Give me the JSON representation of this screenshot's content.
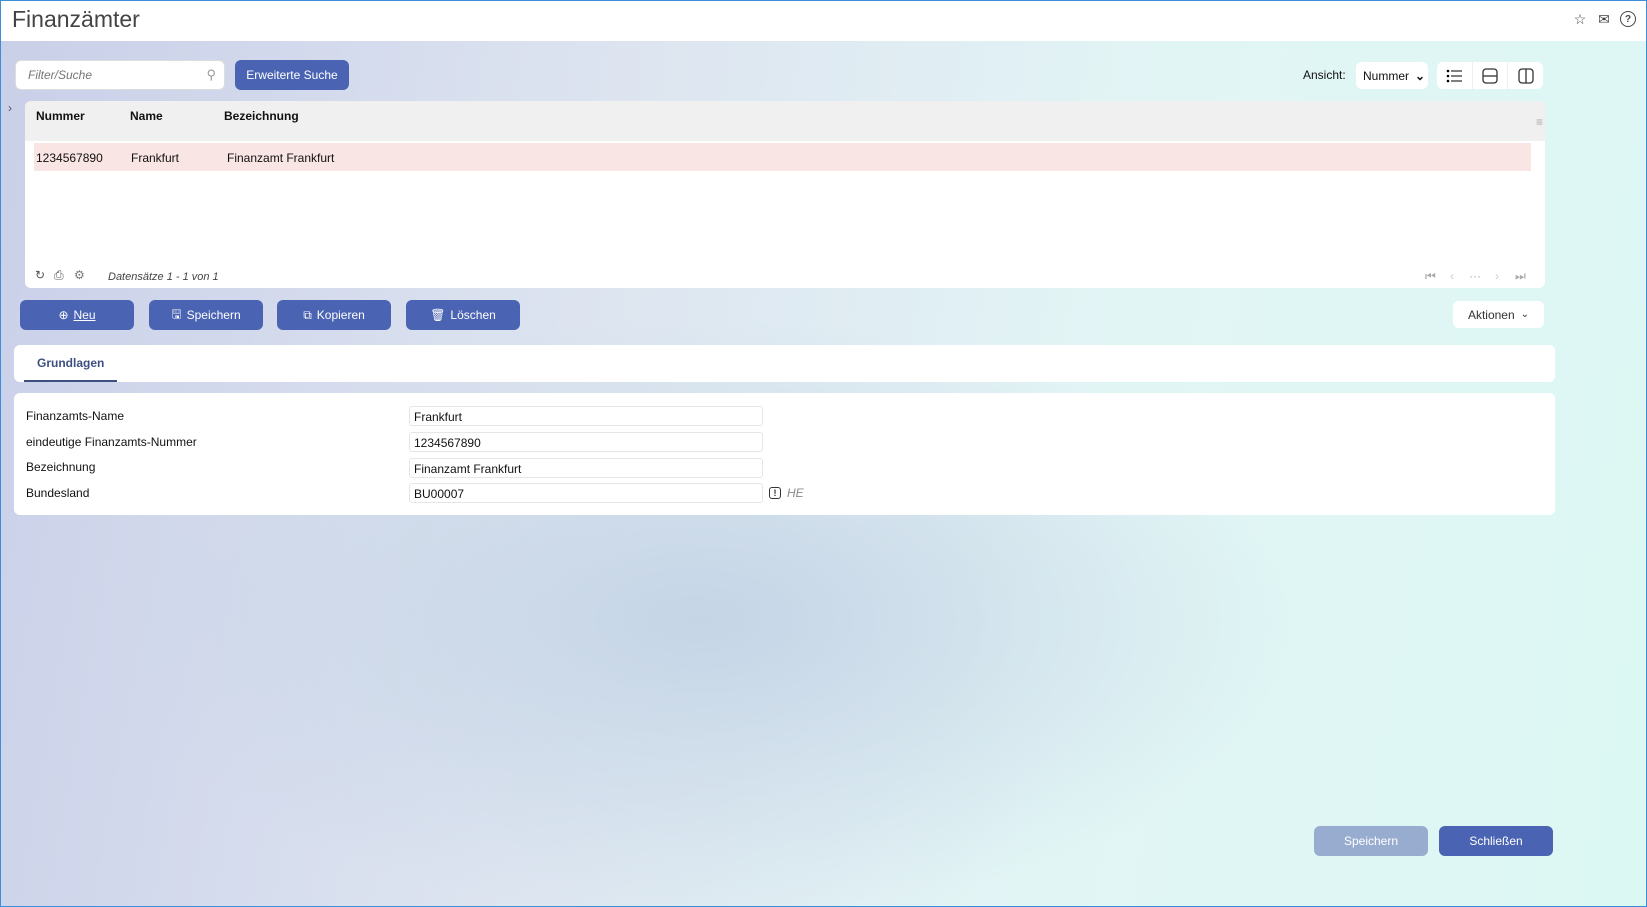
{
  "header": {
    "title": "Finanzämter"
  },
  "toolbar": {
    "search_placeholder": "Filter/Suche",
    "advanced_search": "Erweiterte Suche",
    "view_label": "Ansicht:",
    "view_selected": "Nummer"
  },
  "grid": {
    "columns": [
      "Nummer",
      "Name",
      "Bezeichnung"
    ],
    "rows": [
      [
        "1234567890",
        "Frankfurt",
        "Finanzamt Frankfurt"
      ]
    ],
    "records": "Datensätze 1 - 1 von 1",
    "pager_ellipsis": "···"
  },
  "actions": {
    "new": "Neu",
    "save": "Speichern",
    "copy": "Kopieren",
    "delete": "Löschen",
    "more": "Aktionen"
  },
  "tabs": [
    {
      "label": "Grundlagen"
    }
  ],
  "form": {
    "fields": [
      {
        "label": "Finanzamts-Name",
        "value": "Frankfurt"
      },
      {
        "label": "eindeutige Finanzamts-Nummer",
        "value": "1234567890"
      },
      {
        "label": "Bezeichnung",
        "value": "Finanzamt Frankfurt"
      },
      {
        "label": "Bundesland",
        "value": "BU00007",
        "hint": "HE"
      }
    ]
  },
  "footer": {
    "save": "Speichern",
    "close": "Schließen"
  },
  "colors": {
    "primary": "#4a63b3",
    "selected_row": "#f9e5e3",
    "disabled": "#98acd0"
  }
}
